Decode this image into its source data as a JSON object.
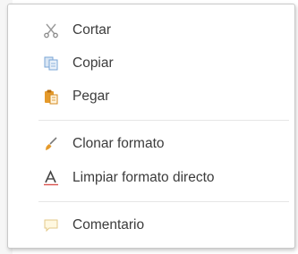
{
  "menu": {
    "items": [
      {
        "id": "cut",
        "label": "Cortar",
        "icon": "scissors-icon"
      },
      {
        "id": "copy",
        "label": "Copiar",
        "icon": "copy-icon"
      },
      {
        "id": "paste",
        "label": "Pegar",
        "icon": "clipboard-paste-icon"
      },
      {
        "id": "clone-format",
        "label": "Clonar formato",
        "icon": "paintbrush-icon"
      },
      {
        "id": "clear-direct-format",
        "label": "Limpiar formato directo",
        "icon": "clear-formatting-icon"
      },
      {
        "id": "comment",
        "label": "Comentario",
        "icon": "comment-icon"
      }
    ]
  },
  "colors": {
    "menu_background": "#ffffff",
    "menu_border": "#c9c9c9",
    "text": "#3c3c3c",
    "separator": "#e6e6e6",
    "icon_gray": "#8a8a8a",
    "icon_blue": "#7aa6d6",
    "icon_orange": "#e59a2b",
    "icon_dark": "#444444"
  }
}
